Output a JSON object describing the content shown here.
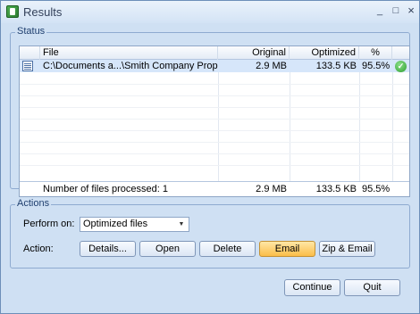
{
  "window": {
    "title": "Results",
    "minimize_glyph": "_",
    "maximize_glyph": "□",
    "close_glyph": "×"
  },
  "status": {
    "group_label": "Status",
    "columns": {
      "file": "File",
      "original": "Original",
      "optimized": "Optimized",
      "percent": "%"
    },
    "rows": [
      {
        "file": "C:\\Documents a...\\Smith Company Proposal.doc",
        "original": "2.9 MB",
        "optimized": "133.5 KB",
        "percent": "95.5%",
        "icon": "word-document-icon",
        "status_icon": "success-check-icon"
      }
    ],
    "footer": {
      "files_processed": "Number of files processed: 1",
      "original": "2.9 MB",
      "optimized": "133.5 KB",
      "percent": "95.5%"
    }
  },
  "actions": {
    "group_label": "Actions",
    "perform_on_label": "Perform on:",
    "perform_on_value": "Optimized files",
    "action_label": "Action:",
    "buttons": {
      "details": "Details...",
      "open": "Open",
      "delete": "Delete",
      "email": "Email",
      "zip_email": "Zip & Email"
    }
  },
  "footer_buttons": {
    "continue": "Continue",
    "quit": "Quit"
  },
  "colors": {
    "window_bg": "#cfe0f3",
    "selection": "#d6e6fa",
    "highlight_button": "#fbbd48"
  }
}
